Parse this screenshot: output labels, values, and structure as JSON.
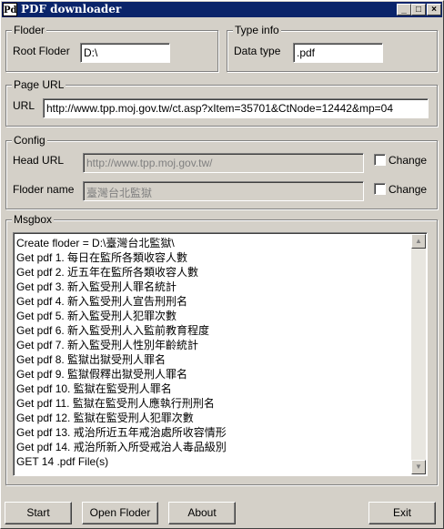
{
  "window": {
    "title": "PDF downloader",
    "icon_letters": "Pd"
  },
  "floder_group": {
    "legend": "Floder",
    "root_label": "Root Floder",
    "root_value": "D:\\"
  },
  "type_group": {
    "legend": "Type info",
    "data_type_label": "Data type",
    "data_type_value": ".pdf"
  },
  "page_url_group": {
    "legend": "Page URL",
    "url_label": "URL",
    "url_value": "http://www.tpp.moj.gov.tw/ct.asp?xItem=35701&CtNode=12442&mp=04"
  },
  "config_group": {
    "legend": "Config",
    "head_url_label": "Head URL",
    "head_url_value": "http://www.tpp.moj.gov.tw/",
    "floder_name_label": "Floder name",
    "floder_name_value": "臺灣台北監獄",
    "change_label_1": "Change",
    "change_label_2": "Change"
  },
  "msgbox": {
    "legend": "Msgbox",
    "lines": [
      "Create floder = D:\\臺灣台北監獄\\",
      "Get pdf 1. 每日在監所各類收容人數",
      "Get pdf 2. 近五年在監所各類收容人數",
      "Get pdf 3. 新入監受刑人罪名統計",
      "Get pdf 4. 新入監受刑人宣告刑刑名",
      "Get pdf 5. 新入監受刑人犯罪次數",
      "Get pdf 6. 新入監受刑人入監前教育程度",
      "Get pdf 7. 新入監受刑人性別年齡統計",
      "Get pdf 8. 監獄出獄受刑人罪名",
      "Get pdf 9. 監獄假釋出獄受刑人罪名",
      "Get pdf 10. 監獄在監受刑人罪名",
      "Get pdf 11. 監獄在監受刑人應執行刑刑名",
      "Get pdf 12. 監獄在監受刑人犯罪次數",
      "Get pdf 13. 戒治所近五年戒治處所收容情形",
      "Get pdf 14. 戒治所新入所受戒治人毒品級別",
      "GET 14 .pdf File(s)"
    ]
  },
  "buttons": {
    "start": "Start",
    "open_floder": "Open Floder",
    "about": "About",
    "exit": "Exit"
  },
  "caption_buttons": {
    "minimize": "_",
    "maximize": "□",
    "close": "×"
  }
}
